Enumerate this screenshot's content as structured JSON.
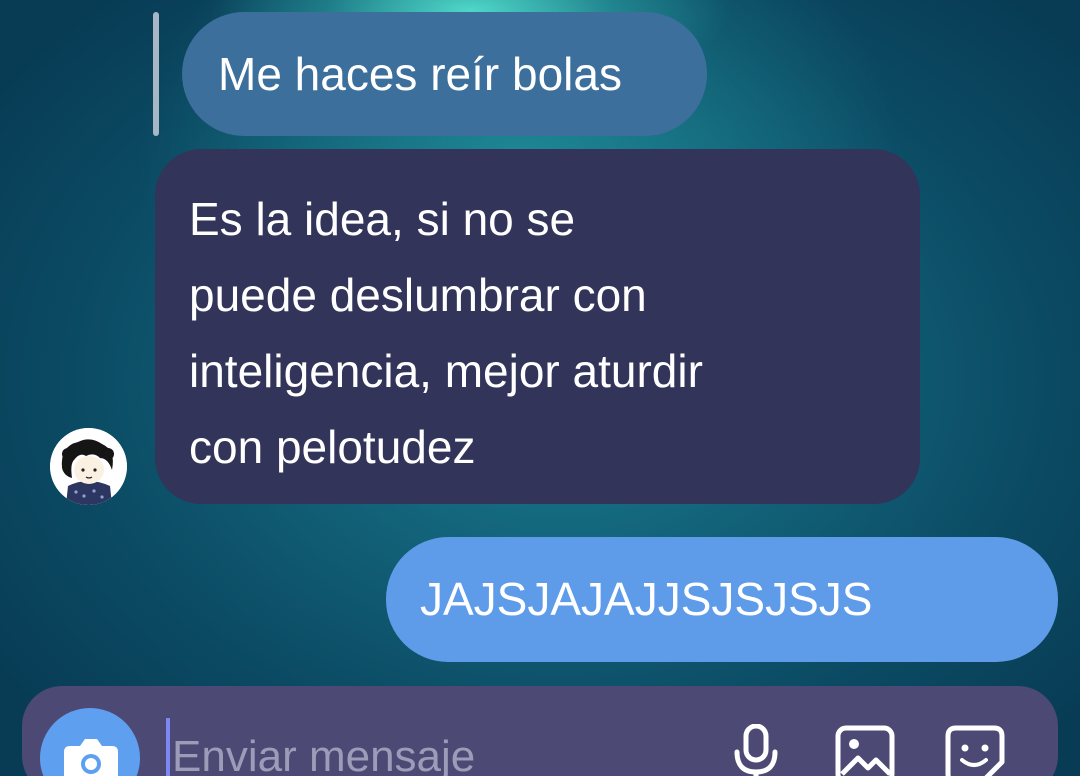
{
  "conversation": {
    "quoted_message": "Me haces reír bolas",
    "received_message": {
      "lines": [
        "Es la idea, si no se",
        "puede deslumbrar con",
        "inteligencia, mejor aturdir",
        "con pelotudez"
      ]
    },
    "sent_message": "JAJSJAJAJJSJSJSJS"
  },
  "composer": {
    "placeholder": "Enviar mensaje",
    "value": "",
    "icons": [
      "camera-icon",
      "microphone-icon",
      "image-icon",
      "sticker-icon"
    ]
  },
  "colors": {
    "quoted_bubble": "#3d6f9c",
    "received_bubble": "#32345a",
    "sent_bubble": "#5e9be9",
    "composer": "#4c4a74",
    "camera_button": "#5e9ff0"
  }
}
